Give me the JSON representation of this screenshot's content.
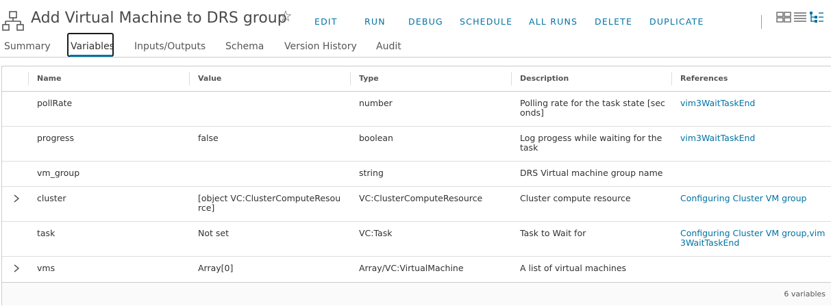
{
  "header": {
    "title": "Add Virtual Machine to DRS group",
    "actions": [
      "EDIT",
      "RUN",
      "DEBUG",
      "SCHEDULE",
      "ALL RUNS",
      "DELETE",
      "DUPLICATE"
    ]
  },
  "tabs": [
    "Summary",
    "Variables",
    "Inputs/Outputs",
    "Schema",
    "Version History",
    "Audit"
  ],
  "active_tab": "Variables",
  "grid": {
    "columns": [
      "Name",
      "Value",
      "Type",
      "Description",
      "References"
    ],
    "rows": [
      {
        "name": "pollRate",
        "value": "",
        "type": "number",
        "description": "Polling rate for the task state [seconds]",
        "references": "vim3WaitTaskEnd",
        "expandable": false
      },
      {
        "name": "progress",
        "value": "false",
        "type": "boolean",
        "description": "Log progess while waiting for the task",
        "references": "vim3WaitTaskEnd",
        "expandable": false
      },
      {
        "name": "vm_group",
        "value": "",
        "type": "string",
        "description": "DRS Virtual machine group name",
        "references": "",
        "expandable": false
      },
      {
        "name": "cluster",
        "value": "[object VC:ClusterComputeResource]",
        "type": "VC:ClusterComputeResource",
        "description": "Cluster compute resource",
        "references": "Configuring Cluster VM group",
        "expandable": true
      },
      {
        "name": "task",
        "value": "Not set",
        "type": "VC:Task",
        "description": "Task to Wait for",
        "references": "Configuring Cluster VM group,vim3WaitTaskEnd",
        "expandable": false
      },
      {
        "name": "vms",
        "value": "Array[0]",
        "type": "Array/VC:VirtualMachine",
        "description": "A list of virtual machines",
        "references": "",
        "expandable": true
      }
    ],
    "footer": "6 variables"
  },
  "colors": {
    "accent": "#0072a3",
    "text": "#313131",
    "border": "#cccccc"
  },
  "icons": {
    "workflow": "workflow-icon",
    "favorite": "star-outline-icon",
    "view_card": "card-view-icon",
    "view_list": "list-view-icon",
    "view_tree": "tree-view-icon",
    "expand": "chevron-right-icon"
  }
}
